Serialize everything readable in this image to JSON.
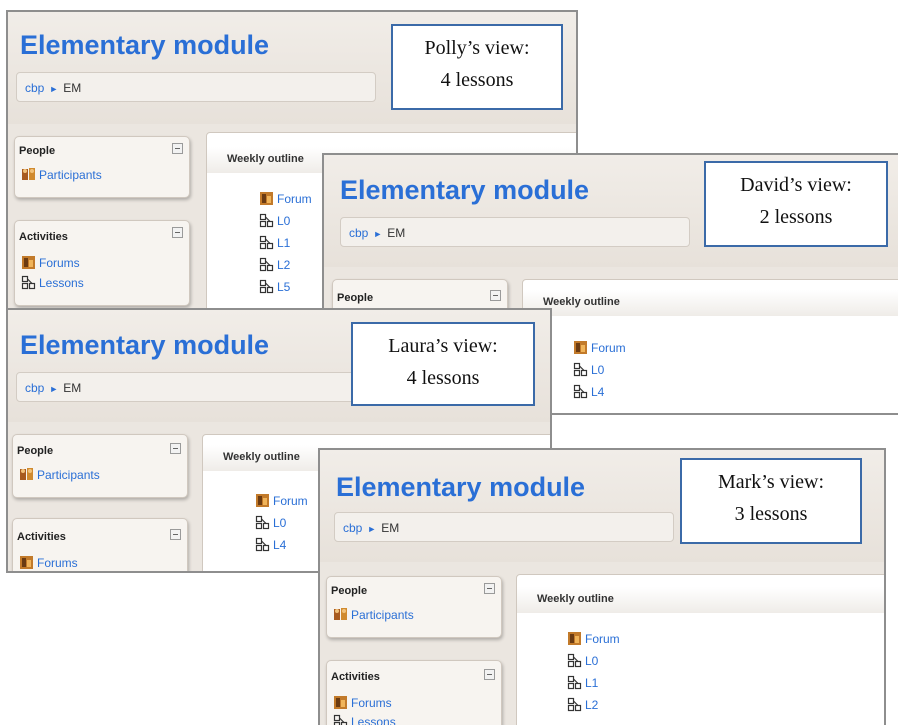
{
  "views": [
    {
      "key": "polly",
      "title": "Elementary module",
      "breadcrumb": {
        "home": "cbp",
        "current": "EM"
      },
      "view_label": {
        "line1": "Polly’s view:",
        "line2": "4 lessons"
      },
      "people_block": {
        "title": "People",
        "items": [
          "Participants"
        ]
      },
      "activities_block": {
        "title": "Activities",
        "items": [
          "Forums",
          "Lessons"
        ]
      },
      "outline": {
        "header": "Weekly outline",
        "items": [
          "Forum",
          "L0",
          "L1",
          "L2",
          "L5"
        ]
      }
    },
    {
      "key": "david",
      "title": "Elementary module",
      "breadcrumb": {
        "home": "cbp",
        "current": "EM"
      },
      "view_label": {
        "line1": "David’s view:",
        "line2": "2 lessons"
      },
      "people_block": {
        "title": "People",
        "items": []
      },
      "outline": {
        "header": "Weekly outline",
        "items": [
          "Forum",
          "L0",
          "L4"
        ]
      }
    },
    {
      "key": "laura",
      "title": "Elementary module",
      "breadcrumb": {
        "home": "cbp",
        "current": "EM"
      },
      "view_label": {
        "line1": "Laura’s view:",
        "line2": "4 lessons"
      },
      "people_block": {
        "title": "People",
        "items": [
          "Participants"
        ]
      },
      "activities_block": {
        "title": "Activities",
        "items": [
          "Forums"
        ]
      },
      "outline": {
        "header": "Weekly outline",
        "items": [
          "Forum",
          "L0",
          "L4"
        ]
      }
    },
    {
      "key": "mark",
      "title": "Elementary module",
      "breadcrumb": {
        "home": "cbp",
        "current": "EM"
      },
      "view_label": {
        "line1": "Mark’s view:",
        "line2": "3 lessons"
      },
      "people_block": {
        "title": "People",
        "items": [
          "Participants"
        ]
      },
      "activities_block": {
        "title": "Activities",
        "items": [
          "Forums",
          "Lessons"
        ]
      },
      "outline": {
        "header": "Weekly outline",
        "items": [
          "Forum",
          "L0",
          "L1",
          "L2"
        ]
      }
    }
  ],
  "icons": {
    "forum": "forum-icon",
    "lesson": "lesson-icon",
    "participants": "participants-icon",
    "collapse": "collapse-icon",
    "breadcrumb_separator": "breadcrumb-arrow-icon"
  },
  "colors": {
    "title_blue": "#2a6fd6",
    "link_blue": "#2a6fd6",
    "view_box_border": "#3b6aa8",
    "panel_bg": "#ebe6e0"
  }
}
